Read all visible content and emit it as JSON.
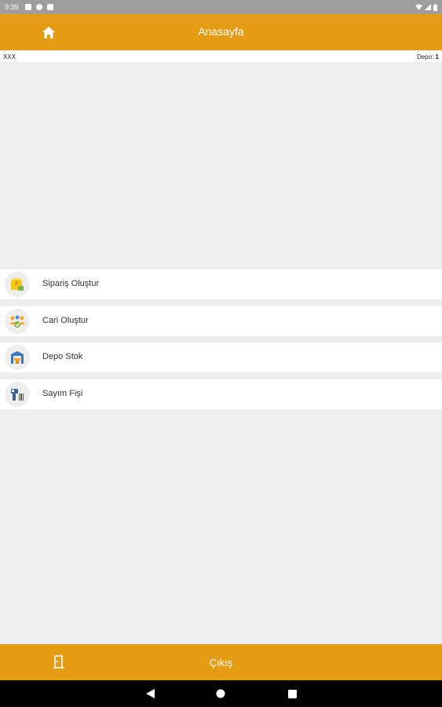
{
  "status_bar": {
    "time": "9:39"
  },
  "app_bar": {
    "title": "Anasayfa",
    "home_icon": "home-icon"
  },
  "info": {
    "user": "XXX",
    "depo_label": "Depo:",
    "depo_value": "1"
  },
  "menu": {
    "items": [
      {
        "label": "Sipariş Oluştur",
        "icon": "order-box-icon"
      },
      {
        "label": "Cari Oluştur",
        "icon": "customer-icon"
      },
      {
        "label": "Depo Stok",
        "icon": "warehouse-icon"
      },
      {
        "label": "Sayım Fişi",
        "icon": "barcode-scanner-icon"
      }
    ]
  },
  "bottom_bar": {
    "exit_label": "Çıkış",
    "exit_icon": "door-exit-icon"
  },
  "colors": {
    "accent": "#e39c13",
    "background": "#eeeeee",
    "status_bar": "#9e9e9e",
    "nav_bar": "#000000"
  }
}
